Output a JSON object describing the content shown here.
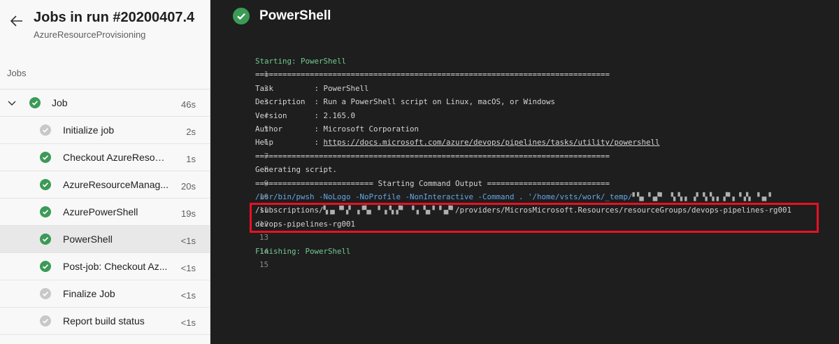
{
  "header": {
    "run_title": "Jobs in run #20200407.4",
    "pipeline_name": "AzureResourceProvisioning",
    "jobs_label": "Jobs"
  },
  "jobs": [
    {
      "name": "Job",
      "duration": "46s",
      "status": "succeeded"
    }
  ],
  "steps": [
    {
      "name": "Initialize job",
      "duration": "2s",
      "status": "skipped"
    },
    {
      "name": "Checkout AzureResourc...",
      "duration": "1s",
      "status": "succeeded"
    },
    {
      "name": "AzureResourceManag...",
      "duration": "20s",
      "status": "succeeded"
    },
    {
      "name": "AzurePowerShell",
      "duration": "19s",
      "status": "succeeded"
    },
    {
      "name": "PowerShell",
      "duration": "<1s",
      "status": "succeeded",
      "selected": true
    },
    {
      "name": "Post-job: Checkout Az...",
      "duration": "<1s",
      "status": "succeeded"
    },
    {
      "name": "Finalize Job",
      "duration": "<1s",
      "status": "skipped"
    },
    {
      "name": "Report build status",
      "duration": "<1s",
      "status": "skipped"
    }
  ],
  "log_panel": {
    "title": "PowerShell",
    "lines": [
      {
        "num": "1",
        "text": "Starting: PowerShell"
      },
      {
        "num": "2",
        "text": "=============================================================================="
      },
      {
        "num": "3",
        "text": "Task         : PowerShell"
      },
      {
        "num": "4",
        "text": "Description  : Run a PowerShell script on Linux, macOS, or Windows"
      },
      {
        "num": "5",
        "text": "Version      : 2.165.0"
      },
      {
        "num": "6",
        "text": "Author       : Microsoft Corporation"
      },
      {
        "num": "7",
        "text_prefix": "Help         : ",
        "link": "https://docs.microsoft.com/azure/devops/pipelines/tasks/utility/powershell"
      },
      {
        "num": "8",
        "text": "=============================================================================="
      },
      {
        "num": "9",
        "text": "Generating script."
      },
      {
        "num": "10",
        "text": "========================== Starting Command Output ==========================="
      },
      {
        "num": "11",
        "text": "/usr/bin/pwsh -NoLogo -NoProfile -NonInteractive -Command . '/home/vsts/work/_temp/",
        "masked": "▘▚▖▝▗▞▘ ▝▖▚▗ ▗▘▝▖▚▗ ▞▘▖▝▗▚ ▝▗▖▘"
      },
      {
        "num": "12",
        "text_prefix": "/subscriptions/",
        "masked": "▚▗▖▝▘▞ ▗▝▚▖ ▘▗▝▖▞▘ ▝▗ ▚▖▘▝▗▞▘",
        "text": "/providers/MicrosMicrosoft.Resources/resourceGroups/devops-pipelines-rg001"
      },
      {
        "num": "13",
        "text": "devops-pipelines-rg001"
      },
      {
        "num": "14",
        "text": ""
      },
      {
        "num": "15",
        "text": "Finishing: PowerShell"
      }
    ]
  },
  "colors": {
    "success": "#3c9a57",
    "skipped": "#c8c8c8",
    "highlight_border": "#e81123"
  }
}
